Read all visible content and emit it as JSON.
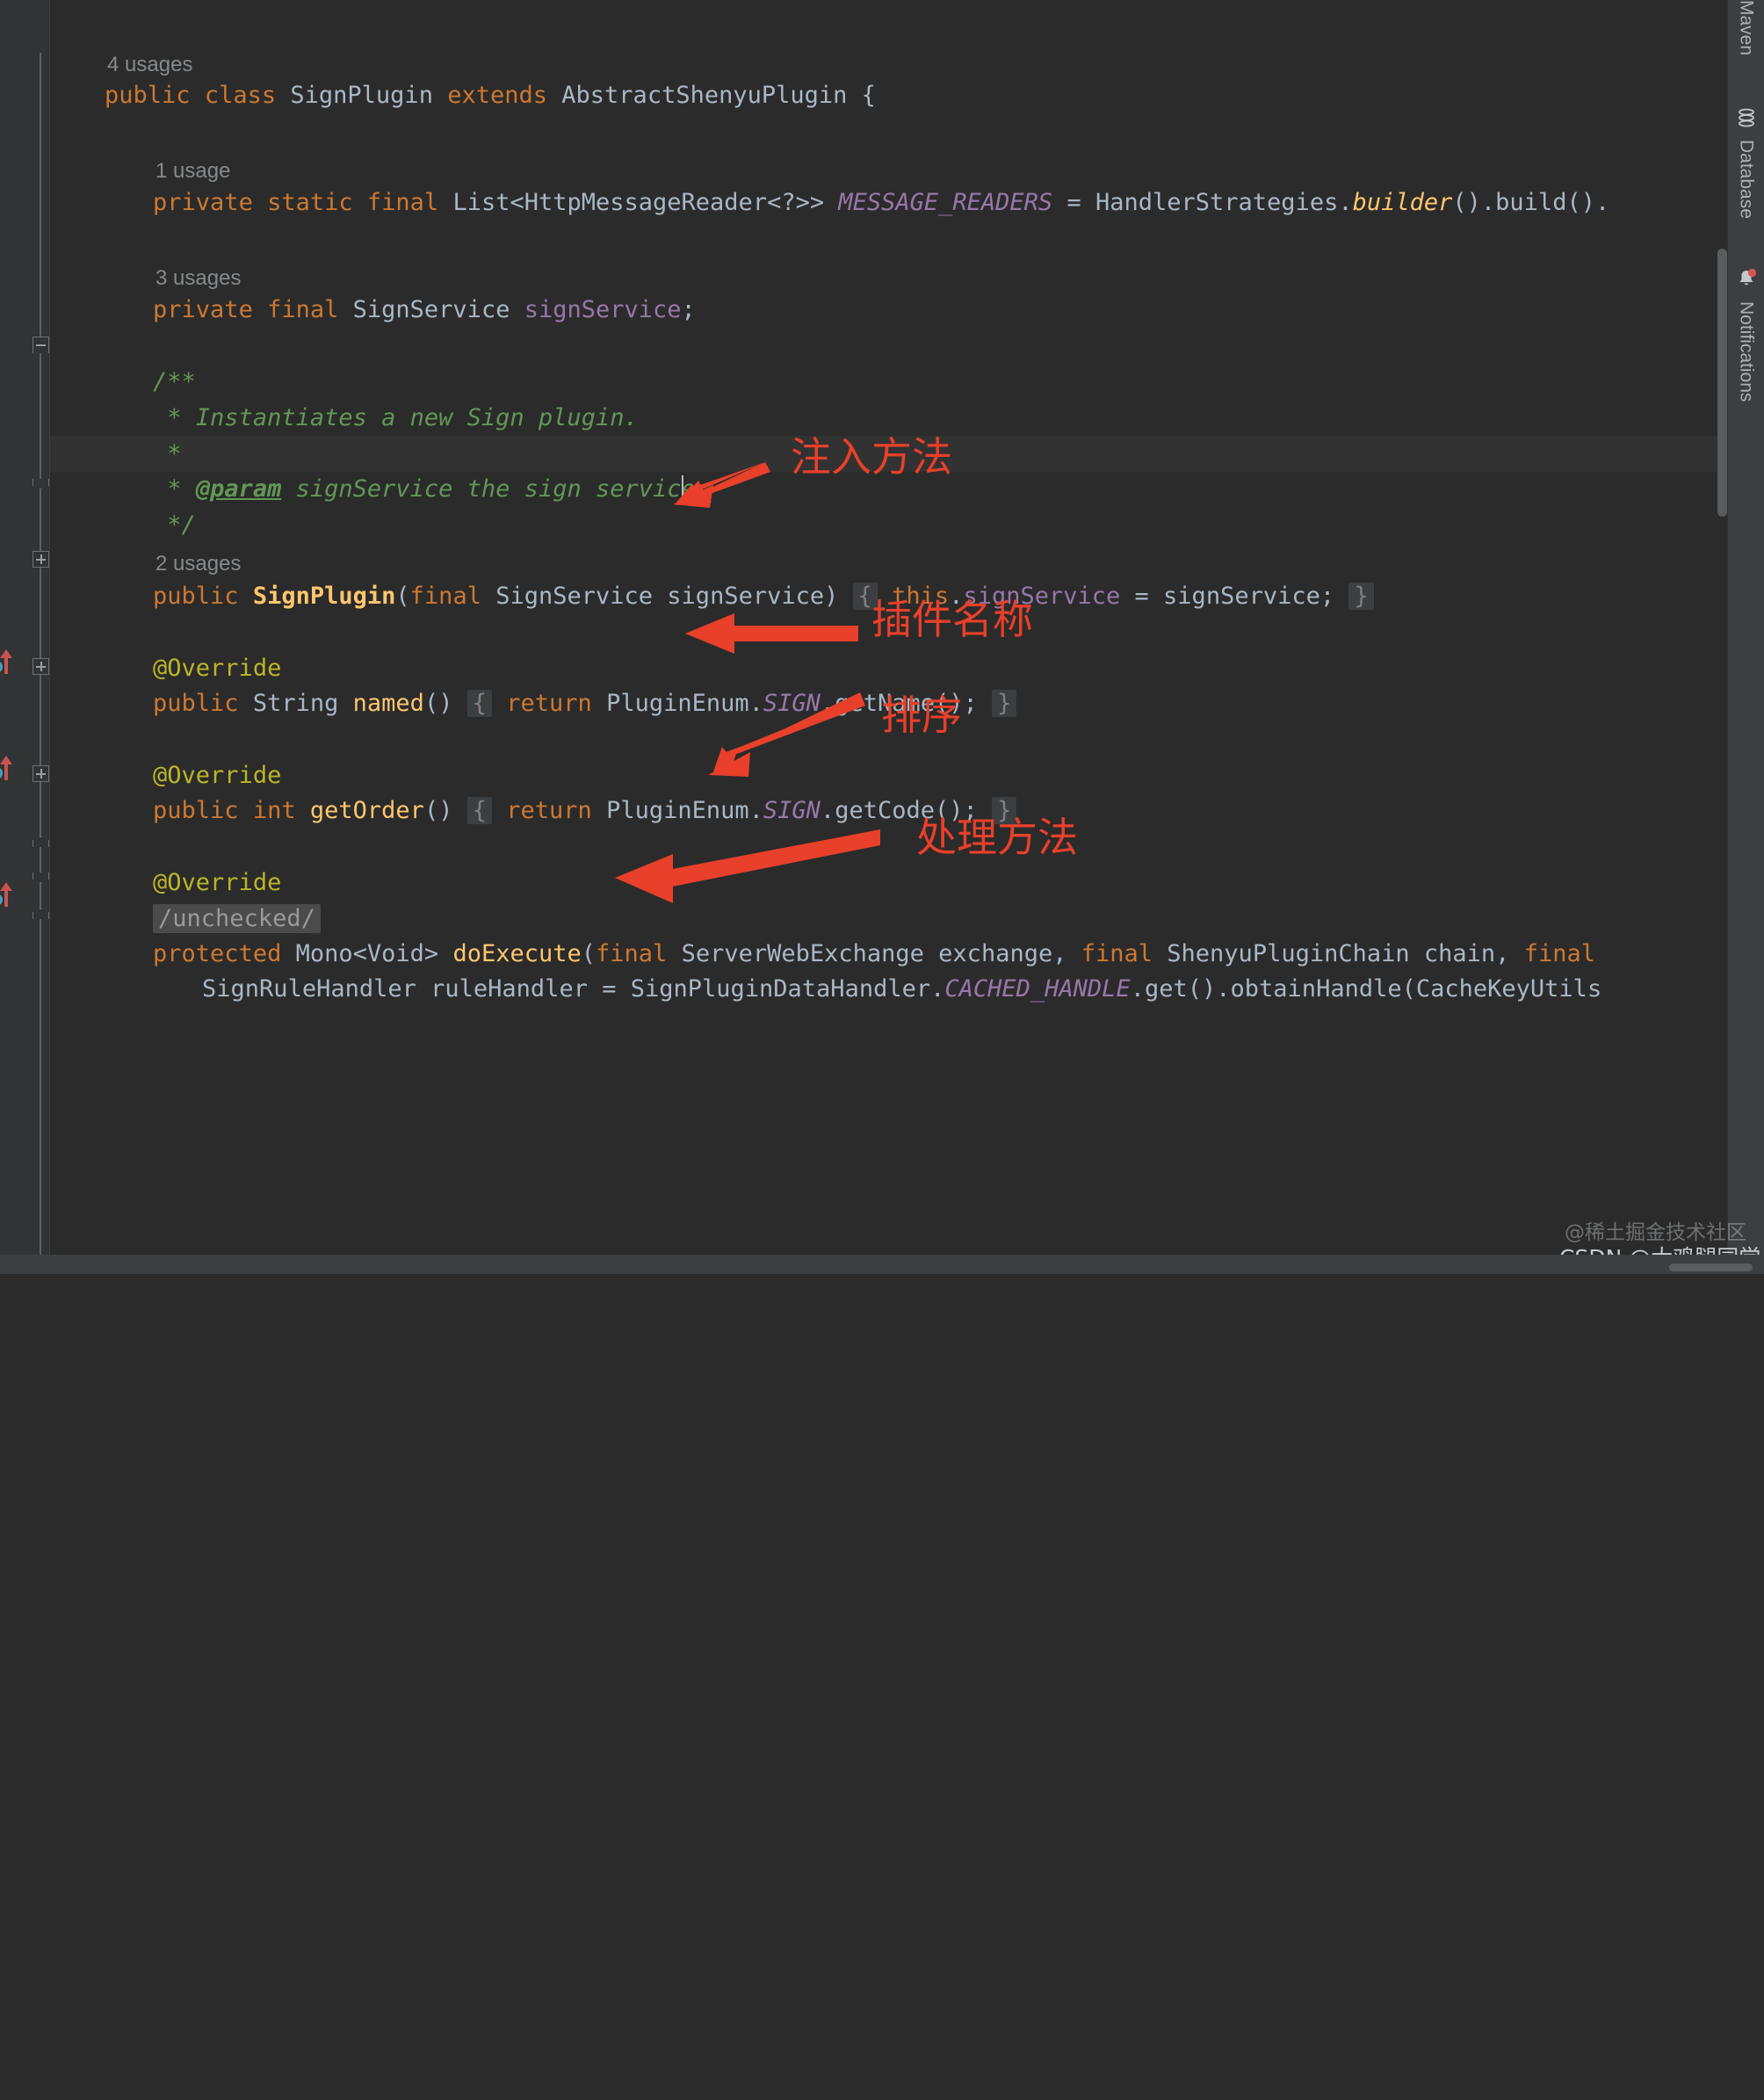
{
  "editor": {
    "theme_bg": "#2B2B2B",
    "gutter_bg": "#313335",
    "current_line_bg": "#323232",
    "lines": [
      {
        "id": "l1",
        "type": "usage",
        "text": "4 usages"
      },
      {
        "id": "l2",
        "type": "code",
        "text": "public class SignPlugin extends AbstractShenyuPlugin {"
      },
      {
        "id": "l3",
        "type": "blank",
        "text": ""
      },
      {
        "id": "l4",
        "type": "usage",
        "text": "1 usage"
      },
      {
        "id": "l5",
        "type": "code",
        "text": "private static final List<HttpMessageReader<?>> MESSAGE_READERS = HandlerStrategies.builder().build()."
      },
      {
        "id": "l6",
        "type": "blank",
        "text": ""
      },
      {
        "id": "l7",
        "type": "usage",
        "text": "3 usages"
      },
      {
        "id": "l8",
        "type": "code",
        "text": "private final SignService signService;"
      },
      {
        "id": "l9",
        "type": "blank",
        "text": ""
      },
      {
        "id": "l10",
        "type": "comment",
        "text": "/**"
      },
      {
        "id": "l11",
        "type": "comment",
        "text": " * Instantiates a new Sign plugin."
      },
      {
        "id": "l12",
        "type": "comment",
        "text": " *"
      },
      {
        "id": "l13",
        "type": "comment",
        "text": " * @param signService the sign service"
      },
      {
        "id": "l14",
        "type": "comment",
        "text": " */"
      },
      {
        "id": "l15",
        "type": "usage",
        "text": "2 usages"
      },
      {
        "id": "l16",
        "type": "code",
        "text": "public SignPlugin(final SignService signService) { this.signService = signService; }"
      },
      {
        "id": "l17",
        "type": "blank",
        "text": ""
      },
      {
        "id": "l18",
        "type": "anno",
        "text": "@Override"
      },
      {
        "id": "l19",
        "type": "code",
        "text": "public String named() { return PluginEnum.SIGN.getName(); }"
      },
      {
        "id": "l20",
        "type": "blank",
        "text": ""
      },
      {
        "id": "l21",
        "type": "anno",
        "text": "@Override"
      },
      {
        "id": "l22",
        "type": "code",
        "text": "public int getOrder() { return PluginEnum.SIGN.getCode(); }"
      },
      {
        "id": "l23",
        "type": "blank",
        "text": ""
      },
      {
        "id": "l24",
        "type": "anno",
        "text": "@Override"
      },
      {
        "id": "l25",
        "type": "fold",
        "text": "/unchecked/"
      },
      {
        "id": "l26",
        "type": "code",
        "text": "protected Mono<Void> doExecute(final ServerWebExchange exchange, final ShenyuPluginChain chain, final"
      },
      {
        "id": "l27",
        "type": "code",
        "text": "SignRuleHandler ruleHandler = SignPluginDataHandler.CACHED_HANDLE.get().obtainHandle(CacheKeyUtils"
      }
    ],
    "tokens": {
      "kw_public": "public",
      "kw_class": "class",
      "kw_extends": "extends",
      "kw_private": "private",
      "kw_static": "static",
      "kw_final": "final",
      "kw_return": "return",
      "kw_this": "this",
      "kw_protected": "protected",
      "kw_int": "int",
      "cls_SignPlugin": "SignPlugin",
      "cls_AbstractShenyuPlugin": "AbstractShenyuPlugin",
      "cls_List": "List<HttpMessageReader<?>>",
      "cls_SignService": "SignService",
      "cls_String": "String",
      "cls_Mono": "Mono<Void>",
      "cls_ServerWebExchange": "ServerWebExchange",
      "cls_ShenyuPluginChain": "ShenyuPluginChain",
      "cls_SignRuleHandler": "SignRuleHandler",
      "cls_SignPluginDataHandler": "SignPluginDataHandler",
      "cls_HandlerStrategies": "HandlerStrategies",
      "cls_PluginEnum": "PluginEnum",
      "cls_CacheKeyUtils": "CacheKeyUtils",
      "const_MESSAGE_READERS": "MESSAGE_READERS",
      "const_CACHED_HANDLE": "CACHED_HANDLE",
      "const_SIGN": "SIGN",
      "var_signService": "signService",
      "var_exchange": "exchange",
      "var_chain": "chain",
      "var_ruleHandler": "ruleHandler",
      "m_builder": "builder",
      "m_build": "build",
      "m_named": "named",
      "m_getOrder": "getOrder",
      "m_getName": "getName",
      "m_getCode": "getCode",
      "m_get": "get",
      "m_obtainHandle": "obtainHandle",
      "m_doExecute": "doExecute",
      "annotation_override": "@Override",
      "javadoc_param": "@param",
      "folded_brace": "{",
      "folded_unchecked": "/unchecked/"
    }
  },
  "annotations": {
    "accent_color": "#E8402A",
    "items": [
      {
        "id": "a1",
        "label": "注入方法"
      },
      {
        "id": "a2",
        "label": "插件名称"
      },
      {
        "id": "a3",
        "label": "排序"
      },
      {
        "id": "a4",
        "label": "处理方法"
      }
    ]
  },
  "right_toolbar": {
    "buttons": [
      {
        "id": "maven",
        "label": "Maven",
        "icon": "maven-icon"
      },
      {
        "id": "database",
        "label": "Database",
        "icon": "database-icon"
      },
      {
        "id": "notifications",
        "label": "Notifications",
        "icon": "bell-icon",
        "badge": true
      }
    ]
  },
  "watermarks": {
    "juejin": "@稀土掘金技术社区",
    "csdn": "CSDN @大鸡腿同学"
  }
}
